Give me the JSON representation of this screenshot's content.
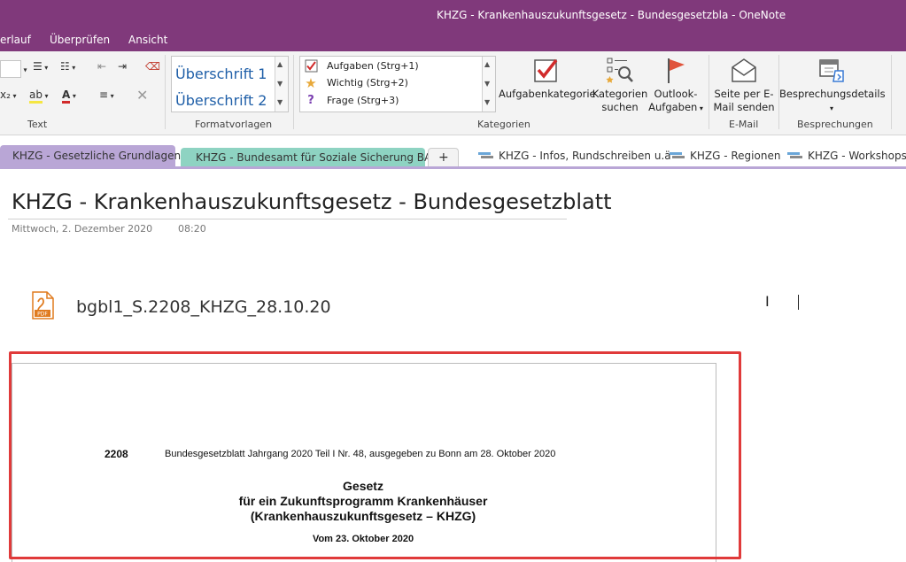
{
  "window": {
    "title": "KHZG - Krankenhauszukunftsgesetz - Bundesgesetzbla - OneNote"
  },
  "menu": {
    "items": [
      "erlauf",
      "Überprüfen",
      "Ansicht"
    ]
  },
  "ribbon": {
    "groups": {
      "text": "Text",
      "styles": "Formatvorlagen",
      "tags": "Kategorien",
      "email": "E-Mail",
      "meetings": "Besprechungen"
    },
    "styles": [
      "Überschrift 1",
      "Überschrift 2"
    ],
    "tags": [
      {
        "label": "Aufgaben (Strg+1)",
        "icon": "checkbox-icon"
      },
      {
        "label": "Wichtig (Strg+2)",
        "icon": "star-icon"
      },
      {
        "label": "Frage (Strg+3)",
        "icon": "question-icon"
      }
    ],
    "buttons": {
      "tag_category": "Aufgabenkategorie",
      "find_tags_1": "Kategorien",
      "find_tags_2": "suchen",
      "outlook_tasks_1": "Outlook-",
      "outlook_tasks_2": "Aufgaben",
      "email_page_1": "Seite per E-",
      "email_page_2": "Mail senden",
      "meeting_details": "Besprechungsdetails"
    }
  },
  "tabs": [
    {
      "label": "KHZG - Gesetzliche Grundlagen",
      "color": "#b9a6d6",
      "active": true
    },
    {
      "label": "KHZG - Bundesamt für Soziale Sicherung BAS",
      "color": "#8ed3c2",
      "active": false
    },
    {
      "label": "+",
      "color": "#f3f3f3",
      "active": false
    },
    {
      "label": "KHZG - Infos, Rundschreiben u.ä",
      "color": "#ffffff",
      "active": false
    },
    {
      "label": "KHZG - Regionen",
      "color": "#ffffff",
      "active": false
    },
    {
      "label": "KHZG - Workshops, P",
      "color": "#ffffff",
      "active": false
    }
  ],
  "page": {
    "title": "KHZG - Krankenhauszukunftsgesetz - Bundesgesetzblatt",
    "date": "Mittwoch, 2. Dezember 2020",
    "time": "08:20",
    "attachment": {
      "name": "bgbl1_S.2208_KHZG_28.10.20",
      "badge": "PDF"
    }
  },
  "printout": {
    "page_number": "2208",
    "header": "Bundesgesetzblatt Jahrgang 2020 Teil I Nr. 48, ausgegeben zu Bonn am 28. Oktober 2020",
    "law_title_1": "Gesetz",
    "law_title_2": "für ein Zukunftsprogramm Krankenhäuser",
    "law_title_3": "(Krankenhauszukunftsgesetz – KHZG)",
    "date_line": "Vom 23. Oktober 2020"
  },
  "colors": {
    "accent": "#80397b",
    "highlight_frame": "#e03a3a"
  }
}
